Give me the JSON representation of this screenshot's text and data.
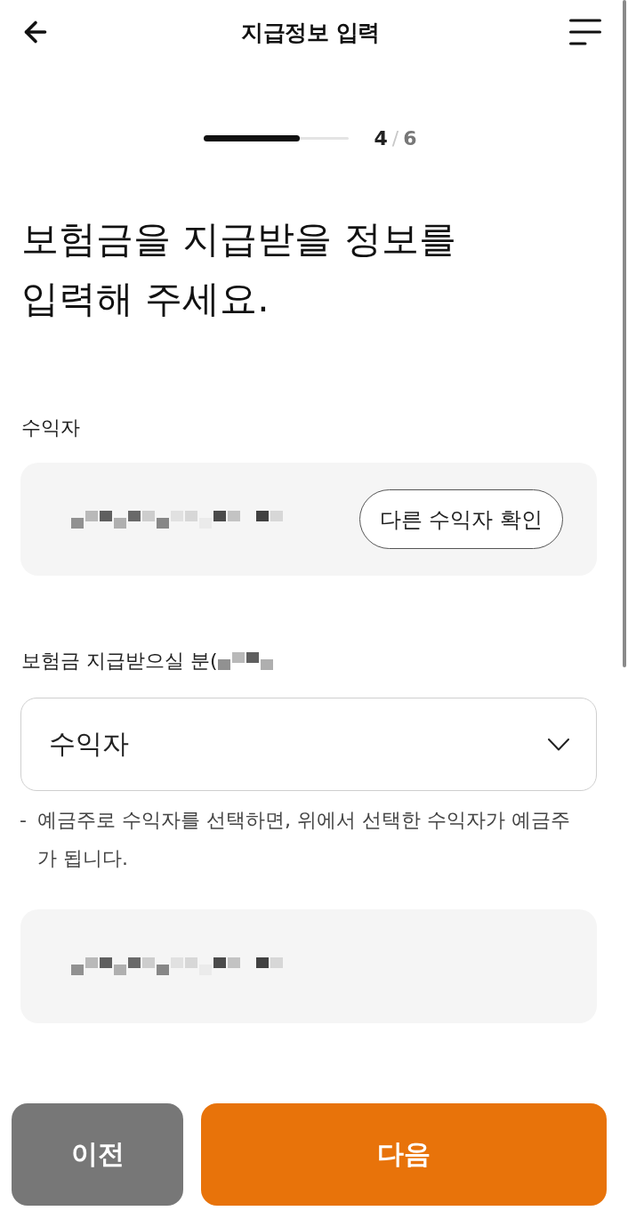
{
  "header": {
    "title": "지급정보 입력"
  },
  "progress": {
    "level": 0.66,
    "current": "4",
    "separator": "/",
    "total": "6"
  },
  "heading_lines": [
    "보험금을 지급받을 정보를",
    "입력해 주세요."
  ],
  "beneficiary": {
    "label": "수익자",
    "button": "다른 수익자 확인"
  },
  "payee": {
    "label": "보험금 지급받으실 분(",
    "select_value": "수익자"
  },
  "note": {
    "bullet": "-",
    "text": "예금주로 수익자를 선택하면, 위에서 선택한 수익자가 예금주가 됩니다."
  },
  "buttons": [
    {
      "label": "이전",
      "kind": "secondary"
    },
    {
      "label": "다음",
      "kind": "primary"
    }
  ]
}
